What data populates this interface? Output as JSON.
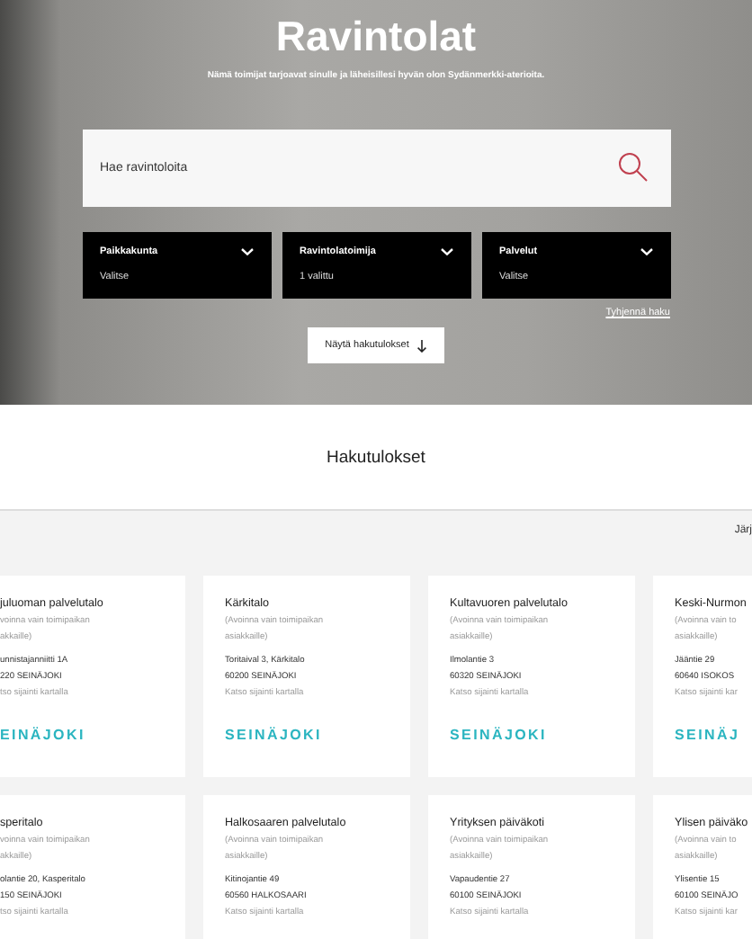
{
  "hero": {
    "title": "Ravintolat",
    "subtitle": "Nämä toimijat tarjoavat sinulle ja läheisillesi hyvän olon Sydänmerkki-aterioita."
  },
  "search": {
    "placeholder": "Hae ravintoloita"
  },
  "filters": [
    {
      "label": "Paikkakunta",
      "value": "Valitse"
    },
    {
      "label": "Ravintolatoimija",
      "value": "1 valittu"
    },
    {
      "label": "Palvelut",
      "value": "Valitse"
    }
  ],
  "clear_link": "Tyhjennä haku",
  "show_button": "Näytä hakutulokset",
  "results": {
    "title": "Hakutulokset",
    "sort_label": "Järj"
  },
  "cards": [
    {
      "name": "juluoman palvelutalo",
      "note": "voinna vain toimipaikan",
      "note2": "akkaille)",
      "address": "unnistajanniitti 1A",
      "city": "220 SEINÄJOKI",
      "map_link": "tso sijainti kartalla",
      "logo": "EINÄJOKI"
    },
    {
      "name": "Kärkitalo",
      "note": "(Avoinna vain toimipaikan",
      "note2": "asiakkaille)",
      "address": "Toritaival 3, Kärkitalo",
      "city": "60200 SEINÄJOKI",
      "map_link": "Katso sijainti kartalla",
      "logo": "SEINÄJOKI"
    },
    {
      "name": "Kultavuoren palvelutalo",
      "note": "(Avoinna vain toimipaikan",
      "note2": "asiakkaille)",
      "address": "Ilmolantie 3",
      "city": "60320 SEINÄJOKI",
      "map_link": "Katso sijainti kartalla",
      "logo": "SEINÄJOKI"
    },
    {
      "name": "Keski-Nurmon",
      "note": "(Avoinna vain to",
      "note2": "asiakkaille)",
      "address": "Jääntie 29",
      "city": "60640 ISOKOS",
      "map_link": "Katso sijainti kar",
      "logo": "SEINÄJ"
    },
    {
      "name": "speritalo",
      "note": "voinna vain toimipaikan",
      "note2": "akkaille)",
      "address": "olantie 20, Kasperitalo",
      "city": "150 SEINÄJOKI",
      "map_link": "tso sijainti kartalla"
    },
    {
      "name": "Halkosaaren palvelutalo",
      "note": "(Avoinna vain toimipaikan",
      "note2": "asiakkaille)",
      "address": "Kitinojantie 49",
      "city": "60560 HALKOSAARI",
      "map_link": "Katso sijainti kartalla"
    },
    {
      "name": "Yrityksen päiväkoti",
      "note": "(Avoinna vain toimipaikan",
      "note2": "asiakkaille)",
      "address": "Vapaudentie 27",
      "city": "60100 SEINÄJOKI",
      "map_link": "Katso sijainti kartalla"
    },
    {
      "name": "Ylisen päiväko",
      "note": "(Avoinna vain to",
      "note2": "asiakkaille)",
      "address": "Ylisentie 15",
      "city": "60100 SEINÄJO",
      "map_link": "Katso sijainti kar"
    }
  ]
}
